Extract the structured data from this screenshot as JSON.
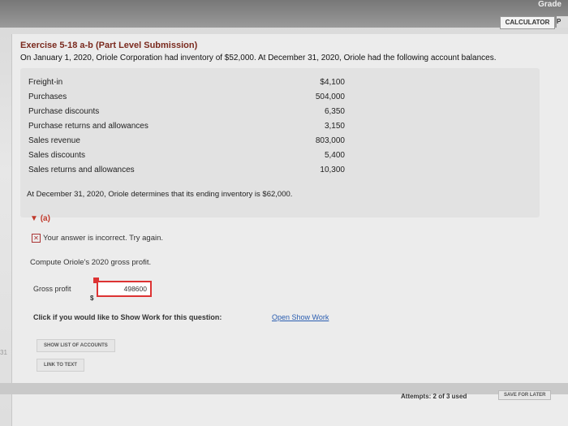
{
  "header": {
    "grade_tab": "Grade",
    "calculator_label": "CALCULATOR",
    "p_label": "P"
  },
  "exercise": {
    "title": "Exercise 5-18 a-b (Part Level Submission)",
    "intro": "On January 1, 2020, Oriole Corporation had inventory of $52,000. At December 31, 2020, Oriole had the following account balances."
  },
  "balances": [
    {
      "label": "Freight-in",
      "value": "$4,100"
    },
    {
      "label": "Purchases",
      "value": "504,000"
    },
    {
      "label": "Purchase discounts",
      "value": "6,350"
    },
    {
      "label": "Purchase returns and allowances",
      "value": "3,150"
    },
    {
      "label": "Sales revenue",
      "value": "803,000"
    },
    {
      "label": "Sales discounts",
      "value": "5,400"
    },
    {
      "label": "Sales returns and allowances",
      "value": "10,300"
    }
  ],
  "ending_text": "At December 31, 2020, Oriole determines that its ending inventory is $62,000.",
  "part": {
    "label": "(a)",
    "feedback": "Your answer is incorrect.  Try again.",
    "feedback_icon": "x-icon",
    "prompt": "Compute Oriole's 2020 gross profit.",
    "gross_profit_label": "Gross profit",
    "gross_profit_value": "498600",
    "currency": "$"
  },
  "show_work": {
    "question": "Click if you would like to Show Work for this question:",
    "link": "Open Show Work"
  },
  "buttons": {
    "show_list": "SHOW LIST OF ACCOUNTS",
    "link_to_text": "LINK TO TEXT",
    "save_later": "SAVE FOR LATER"
  },
  "footer": {
    "attempts": "Attempts: 2 of 3 used",
    "side_number": "31"
  }
}
